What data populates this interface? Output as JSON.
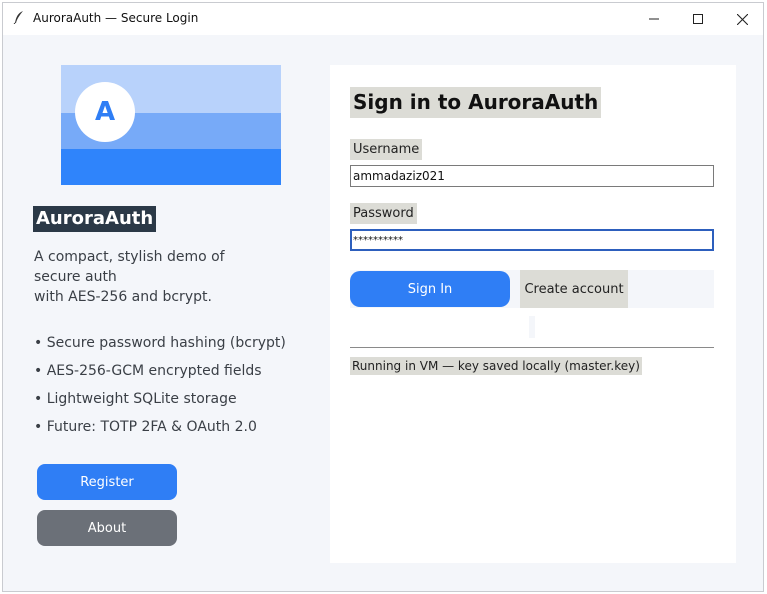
{
  "window": {
    "title": "AuroraAuth — Secure Login",
    "app_icon": "feather-icon",
    "controls": {
      "minimize": "minimize-icon",
      "maximize": "maximize-icon",
      "close": "close-icon"
    }
  },
  "left": {
    "avatar_letter": "A",
    "brand": "AuroraAuth",
    "description": "A compact, stylish demo of secure auth\nwith AES-256 and bcrypt.",
    "features": [
      "• Secure password hashing (bcrypt)",
      "• AES-256-GCM encrypted fields",
      "• Lightweight SQLite storage",
      "• Future: TOTP 2FA & OAuth 2.0"
    ],
    "register_label": "Register",
    "about_label": "About"
  },
  "form": {
    "title": "Sign in to AuroraAuth",
    "username_label": "Username",
    "username_value": "ammadaziz021",
    "password_label": "Password",
    "password_value": "**********",
    "signin_label": "Sign In",
    "create_label": "Create account",
    "status": "Running in VM — key saved locally (master.key)"
  },
  "colors": {
    "accent": "#2f7ef5",
    "about_button": "#6b7078",
    "brand_bg": "#2b3947",
    "label_bg": "#dcdcd6",
    "panel_bg": "#f4f6fa"
  }
}
